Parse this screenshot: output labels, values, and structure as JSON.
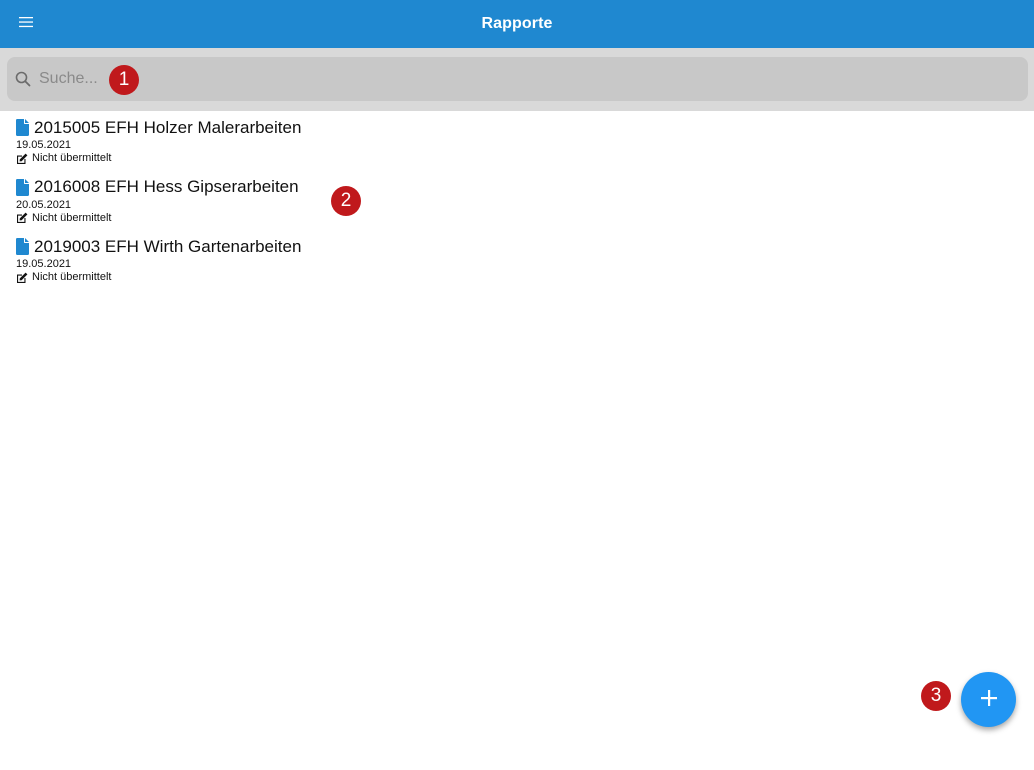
{
  "header": {
    "title": "Rapporte",
    "menu_icon": "hamburger-menu-icon"
  },
  "search": {
    "placeholder": "Suche...",
    "value": ""
  },
  "reports": [
    {
      "title": "2015005 EFH Holzer Malerarbeiten",
      "date": "19.05.2021",
      "status": "Nicht übermittelt"
    },
    {
      "title": "2016008 EFH Hess Gipserarbeiten",
      "date": "20.05.2021",
      "status": "Nicht übermittelt"
    },
    {
      "title": "2019003 EFH Wirth Gartenarbeiten",
      "date": "19.05.2021",
      "status": "Nicht übermittelt"
    }
  ],
  "markers": [
    "1",
    "2",
    "3"
  ],
  "fab": {
    "icon": "plus-icon"
  },
  "colors": {
    "header": "#1f88d0",
    "accent": "#2196f3",
    "marker": "#c0191c"
  }
}
